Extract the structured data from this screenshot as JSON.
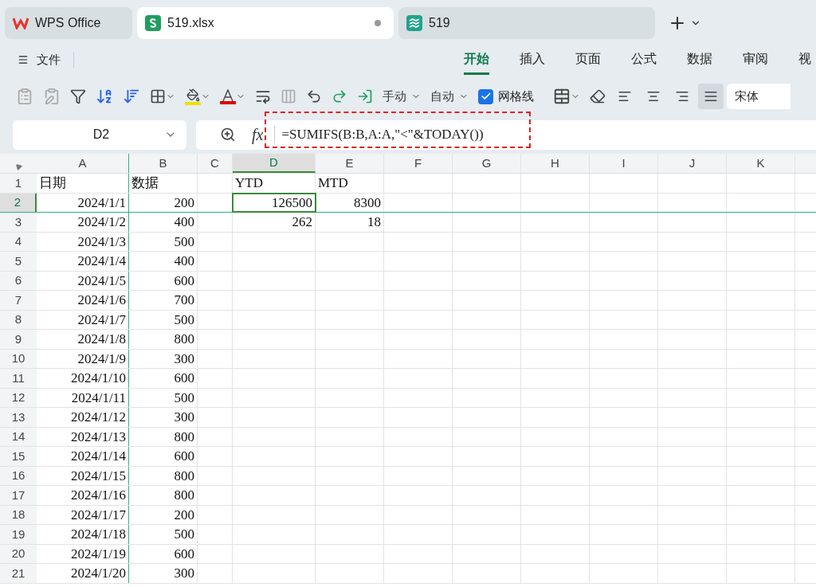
{
  "app_tabs": [
    {
      "kind": "home",
      "label": "WPS Office",
      "selected": false,
      "unsaved": false
    },
    {
      "kind": "sheet",
      "label": "519.xlsx",
      "selected": true,
      "unsaved": true
    },
    {
      "kind": "other",
      "label": "519",
      "selected": false,
      "unsaved": false
    }
  ],
  "menu": {
    "label": "文件"
  },
  "ribbon_tabs": [
    {
      "label": "开始",
      "selected": true
    },
    {
      "label": "插入",
      "selected": false
    },
    {
      "label": "页面",
      "selected": false
    },
    {
      "label": "公式",
      "selected": false
    },
    {
      "label": "数据",
      "selected": false
    },
    {
      "label": "审阅",
      "selected": false
    },
    {
      "label": "视",
      "selected": false
    }
  ],
  "toolbar": {
    "dropdowns": [
      "手动",
      "自动"
    ],
    "gridlines": {
      "label": "网格线",
      "checked": true
    },
    "align": [
      {
        "selected": false
      },
      {
        "selected": false
      },
      {
        "selected": false
      },
      {
        "selected": true
      }
    ],
    "font": "宋体"
  },
  "name_box": "D2",
  "formula": {
    "function_label": "fx",
    "text": "=SUMIFS(B:B,A:A,\"<\"&TODAY())",
    "highlighted": true
  },
  "columns": [
    {
      "label": "A",
      "selected": false
    },
    {
      "label": "B",
      "selected": false
    },
    {
      "label": "C",
      "selected": false
    },
    {
      "label": "D",
      "selected": true
    },
    {
      "label": "E",
      "selected": false
    },
    {
      "label": "F",
      "selected": false
    },
    {
      "label": "G",
      "selected": false
    },
    {
      "label": "H",
      "selected": false
    },
    {
      "label": "I",
      "selected": false
    },
    {
      "label": "J",
      "selected": false
    },
    {
      "label": "K",
      "selected": false
    }
  ],
  "rows": [
    {
      "number": "1",
      "selected": false,
      "kind": "header",
      "cells": {
        "A": "日期",
        "B": "数据",
        "D": "YTD",
        "E": "MTD"
      }
    },
    {
      "number": "2",
      "selected": true,
      "kind": "data",
      "cells": {
        "A": "2024/1/1",
        "B": "200",
        "D": "126500",
        "E": "8300"
      }
    },
    {
      "number": "3",
      "selected": false,
      "kind": "data",
      "cells": {
        "A": "2024/1/2",
        "B": "400",
        "D": "262",
        "E": "18"
      }
    },
    {
      "number": "4",
      "selected": false,
      "kind": "data",
      "cells": {
        "A": "2024/1/3",
        "B": "500"
      }
    },
    {
      "number": "5",
      "selected": false,
      "kind": "data",
      "cells": {
        "A": "2024/1/4",
        "B": "400"
      }
    },
    {
      "number": "6",
      "selected": false,
      "kind": "data",
      "cells": {
        "A": "2024/1/5",
        "B": "600"
      }
    },
    {
      "number": "7",
      "selected": false,
      "kind": "data",
      "cells": {
        "A": "2024/1/6",
        "B": "700"
      }
    },
    {
      "number": "8",
      "selected": false,
      "kind": "data",
      "cells": {
        "A": "2024/1/7",
        "B": "500"
      }
    },
    {
      "number": "9",
      "selected": false,
      "kind": "data",
      "cells": {
        "A": "2024/1/8",
        "B": "800"
      }
    },
    {
      "number": "10",
      "selected": false,
      "kind": "data",
      "cells": {
        "A": "2024/1/9",
        "B": "300"
      }
    },
    {
      "number": "11",
      "selected": false,
      "kind": "data",
      "cells": {
        "A": "2024/1/10",
        "B": "600"
      }
    },
    {
      "number": "12",
      "selected": false,
      "kind": "data",
      "cells": {
        "A": "2024/1/11",
        "B": "500"
      }
    },
    {
      "number": "13",
      "selected": false,
      "kind": "data",
      "cells": {
        "A": "2024/1/12",
        "B": "300"
      }
    },
    {
      "number": "14",
      "selected": false,
      "kind": "data",
      "cells": {
        "A": "2024/1/13",
        "B": "800"
      }
    },
    {
      "number": "15",
      "selected": false,
      "kind": "data",
      "cells": {
        "A": "2024/1/14",
        "B": "600"
      }
    },
    {
      "number": "16",
      "selected": false,
      "kind": "data",
      "cells": {
        "A": "2024/1/15",
        "B": "800"
      }
    },
    {
      "number": "17",
      "selected": false,
      "kind": "data",
      "cells": {
        "A": "2024/1/16",
        "B": "800"
      }
    },
    {
      "number": "18",
      "selected": false,
      "kind": "data",
      "cells": {
        "A": "2024/1/17",
        "B": "200"
      }
    },
    {
      "number": "19",
      "selected": false,
      "kind": "data",
      "cells": {
        "A": "2024/1/18",
        "B": "500"
      }
    },
    {
      "number": "20",
      "selected": false,
      "kind": "data",
      "cells": {
        "A": "2024/1/19",
        "B": "600"
      }
    },
    {
      "number": "21",
      "selected": false,
      "kind": "data",
      "cells": {
        "A": "2024/1/20",
        "B": "300"
      }
    }
  ]
}
